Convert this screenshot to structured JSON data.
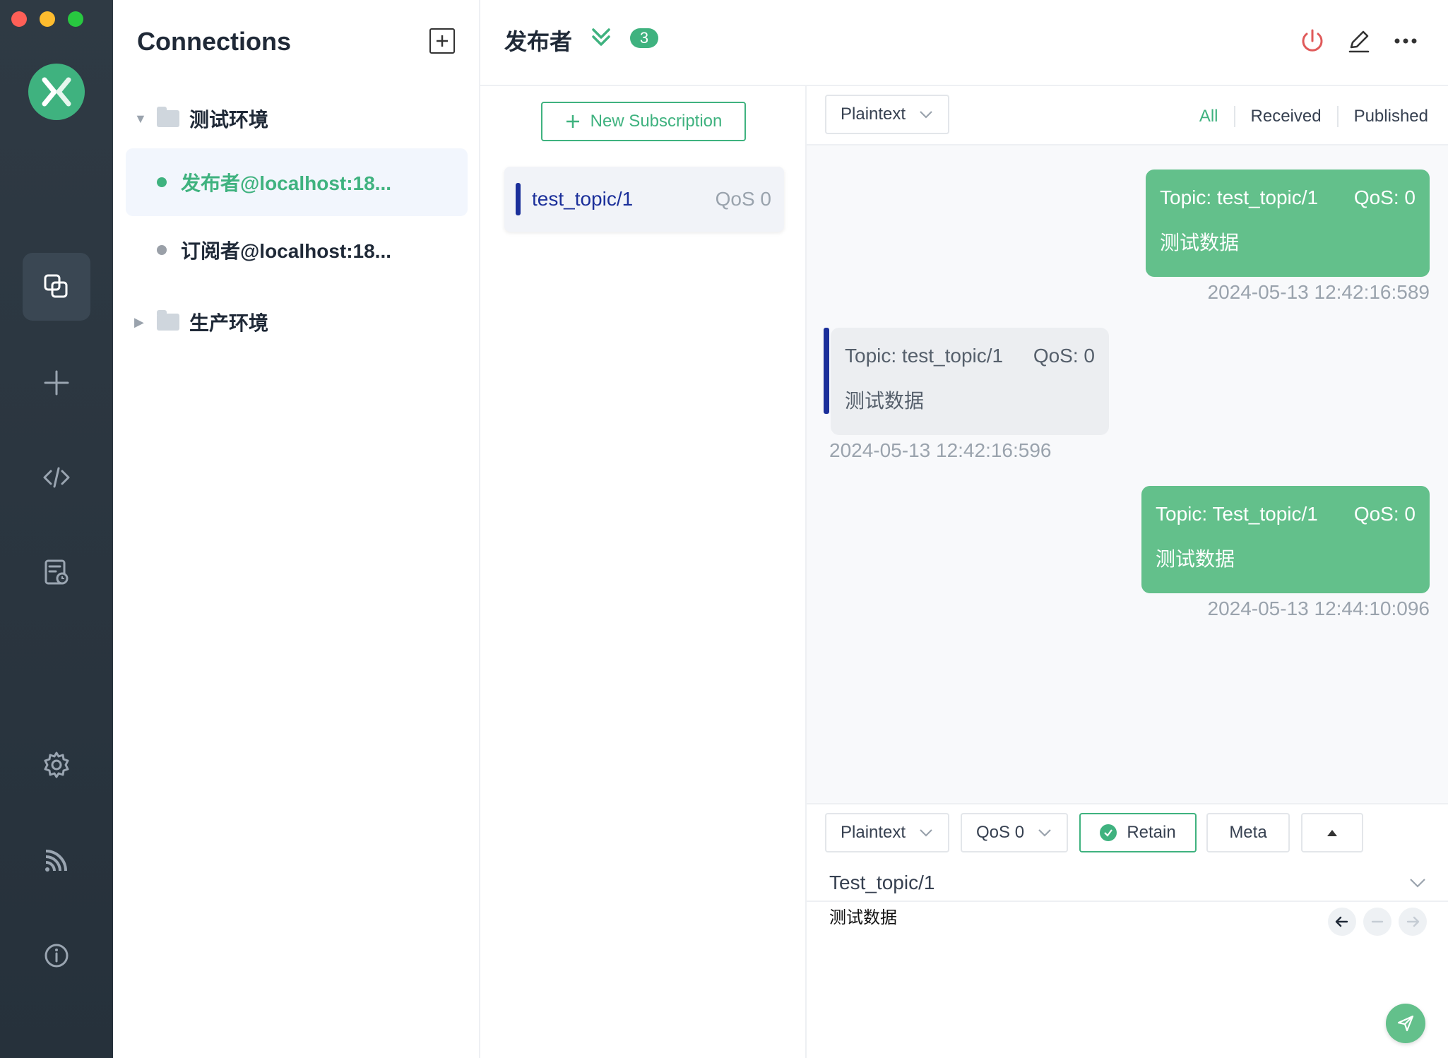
{
  "connections": {
    "title": "Connections",
    "groups": [
      {
        "label": "测试环境",
        "expanded": true,
        "items": [
          {
            "name": "发布者@localhost:18...",
            "active": true,
            "status_color": "#3fb27f"
          },
          {
            "name": "订阅者@localhost:18...",
            "active": false,
            "status_color": "#9aa0a8"
          }
        ]
      },
      {
        "label": "生产环境",
        "expanded": false,
        "items": []
      }
    ]
  },
  "header": {
    "title": "发布者",
    "badge": "3"
  },
  "subscriptions": {
    "new_button": "New Subscription",
    "items": [
      {
        "topic": "test_topic/1",
        "qos": "QoS 0",
        "color": "#1b2f9a"
      }
    ]
  },
  "messages": {
    "format": "Plaintext",
    "tabs": {
      "all": "All",
      "received": "Received",
      "published": "Published",
      "active": "All"
    },
    "list": [
      {
        "direction": "out",
        "topic": "Topic: test_topic/1",
        "qos": "QoS: 0",
        "payload": "测试数据",
        "time": "2024-05-13 12:42:16:589"
      },
      {
        "direction": "in",
        "topic": "Topic: test_topic/1",
        "qos": "QoS: 0",
        "payload": "测试数据",
        "time": "2024-05-13 12:42:16:596"
      },
      {
        "direction": "out",
        "topic": "Topic: Test_topic/1",
        "qos": "QoS: 0",
        "payload": "测试数据",
        "time": "2024-05-13 12:44:10:096"
      }
    ]
  },
  "composer": {
    "format": "Plaintext",
    "qos": "QoS 0",
    "retain_label": "Retain",
    "retain_checked": true,
    "meta_label": "Meta",
    "topic": "Test_topic/1",
    "payload": "测试数据"
  },
  "colors": {
    "accent": "#3fb27f",
    "rail_bg": "#2f3a44",
    "subscription": "#1b2f9a",
    "disconnect": "#e05a5a"
  }
}
